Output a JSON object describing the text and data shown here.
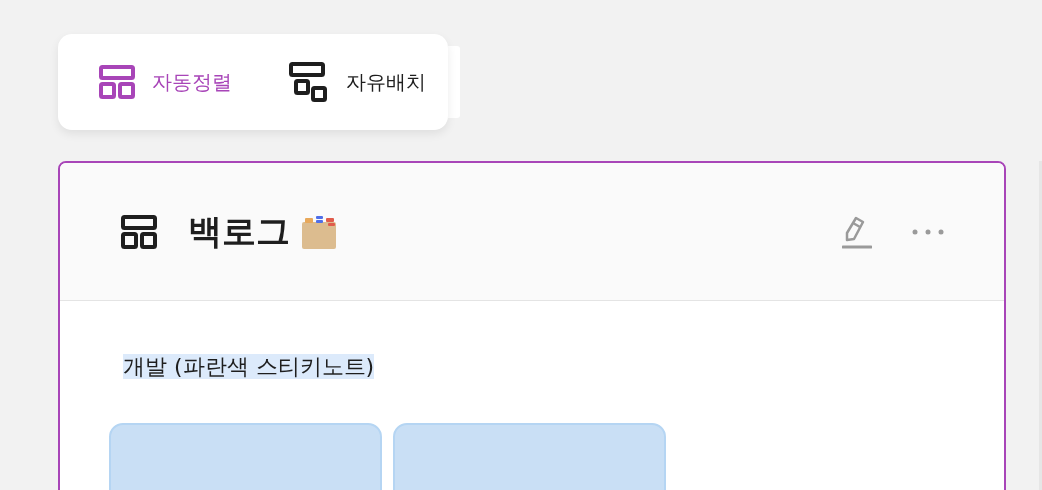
{
  "layout_toggle": [
    {
      "label": "자동정렬",
      "selected": true
    },
    {
      "label": "자유배치",
      "selected": false
    }
  ],
  "board": {
    "title": "백로그",
    "section_label": "개발 (파란색 스티키노트)",
    "section_highlighted": true,
    "notes": [
      {
        "color": "#c9dff5"
      },
      {
        "color": "#c9dff5"
      }
    ]
  }
}
